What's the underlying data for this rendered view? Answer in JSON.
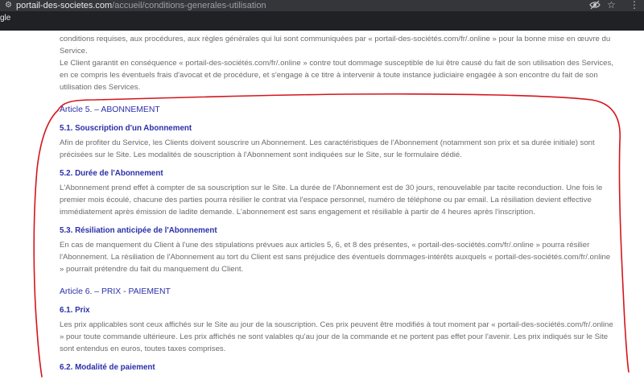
{
  "browser": {
    "url_host": "portail-des-societes.com",
    "url_path": "/accueil/conditions-generales-utilisation",
    "bookmark": "gle"
  },
  "intro": {
    "p1": "conditions requises, aux procédures, aux règles générales qui lui sont communiquées par « portail-des-sociétés.com/fr/.online » pour la bonne mise en œuvre du Service.",
    "p2": "Le Client garantit en conséquence « portail-des-sociétés.com/fr/.online » contre tout dommage susceptible de lui être causé du fait de son utilisation des Services, en ce compris les éventuels frais d'avocat et de procédure, et s'engage à ce titre à intervenir à toute instance judiciaire engagée à son encontre du fait de son utilisation des Services."
  },
  "article5": {
    "title": "Article 5. – ABONNEMENT",
    "s1_title": "5.1. Souscription d'un Abonnement",
    "s1_text": "Afin de profiter du Service, les Clients doivent souscrire un Abonnement. Les caractéristiques de l'Abonnement (notamment son prix et sa durée initiale) sont précisées sur le Site. Les modalités de souscription à l'Abonnement sont indiquées sur le Site, sur le formulaire dédié.",
    "s2_title": "5.2. Durée de l'Abonnement",
    "s2_text": "L'Abonnement prend effet à compter de sa souscription sur le Site. La durée de l'Abonnement est de 30 jours, renouvelable par tacite reconduction. Une fois le premier mois écoulé, chacune des parties pourra résilier le contrat via l'espace personnel, numéro de téléphone ou par email. La résiliation devient effective immédiatement après émission de ladite demande. L'abonnement est sans engagement et résiliable à partir de 4 heures après l'inscription.",
    "s3_title": "5.3. Résiliation anticipée de l'Abonnement",
    "s3_text": "En cas de manquement du Client à l'une des stipulations prévues aux articles 5, 6, et 8 des présentes, « portail-des-sociétés.com/fr/.online » pourra résilier l'Abonnement. La résiliation de l'Abonnement au tort du Client est sans préjudice des éventuels dommages-intérêts auxquels « portail-des-sociétés.com/fr/.online » pourrait prétendre du fait du manquement du Client."
  },
  "article6": {
    "title": "Article 6. – PRIX - PAIEMENT",
    "s1_title": "6.1. Prix",
    "s1_text": "Les prix applicables sont ceux affichés sur le Site au jour de la souscription. Ces prix peuvent être modifiés à tout moment par « portail-des-sociétés.com/fr/.online » pour toute commande ultérieure. Les prix affichés ne sont valables qu'au jour de la commande et ne portent pas effet pour l'avenir. Les prix indiqués sur le Site sont entendus en euros, toutes taxes comprises.",
    "s2_title": "6.2. Modalité de paiement"
  },
  "colors": {
    "heading": "#2b2fa8",
    "body_text": "#6c6c6c",
    "annotation": "#d4161c"
  }
}
